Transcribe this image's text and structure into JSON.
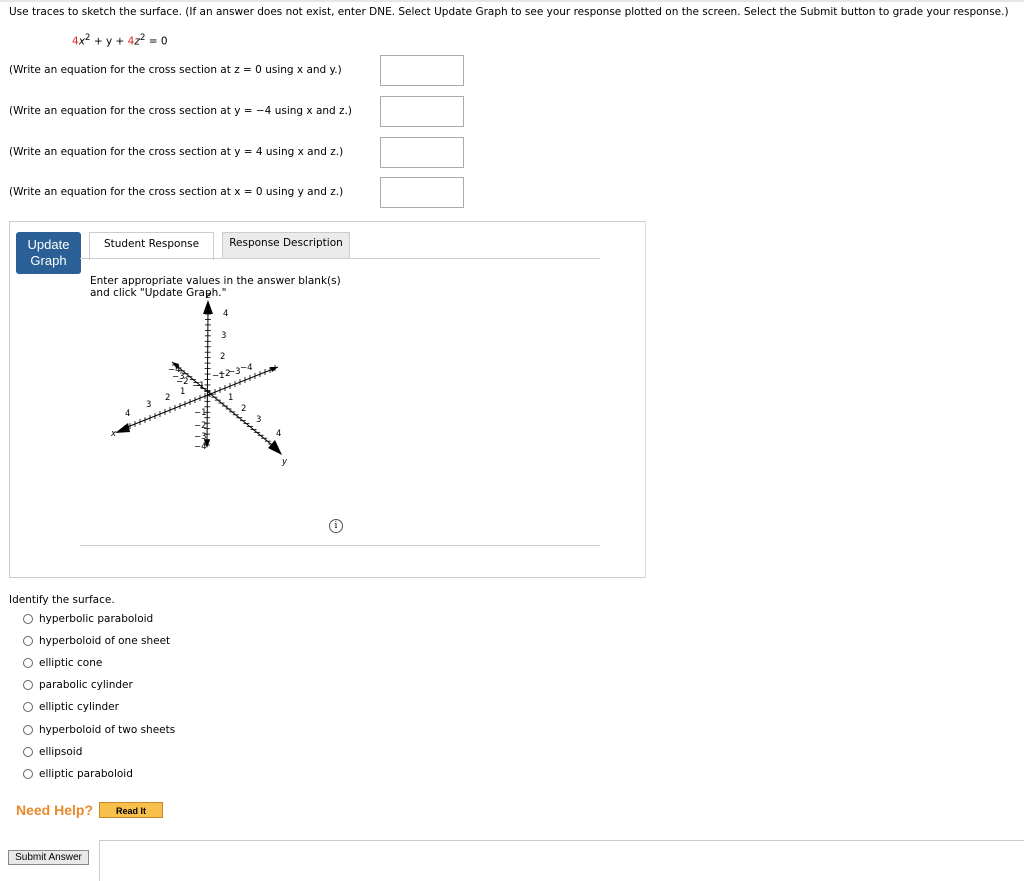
{
  "instructions": "Use traces to sketch the surface. (If an answer does not exist, enter DNE. Select Update Graph to see your response plotted on the screen. Select the Submit button to grade your response.)",
  "equation": {
    "c1": "4",
    "t1": "x",
    "s1": "2",
    "t2": " + y + ",
    "c2": "4",
    "t3": "z",
    "s2": "2",
    "t4": " = 0"
  },
  "questions": [
    {
      "label": "(Write an equation for the cross section at z = 0 using x and y.)",
      "value": ""
    },
    {
      "label": "(Write an equation for the cross section at y = −4 using x and z.)",
      "value": ""
    },
    {
      "label": "(Write an equation for the cross section at y = 4 using x and z.)",
      "value": ""
    },
    {
      "label": "(Write an equation for the cross section at x = 0 using y and z.)",
      "value": ""
    }
  ],
  "graph": {
    "update_label": "Update Graph",
    "tabs": [
      "Student Response",
      "Response Description"
    ],
    "active_tab": "Student Response",
    "message": "Enter appropriate values in the answer blank(s) and click \"Update Graph.\"",
    "axis_x": "x",
    "axis_y": "y",
    "axis_z": "z",
    "info_icon": "info-icon"
  },
  "identify_label": "Identify the surface.",
  "options": [
    "hyperbolic paraboloid",
    "hyperboloid of one sheet",
    "elliptic cone",
    "parabolic cylinder",
    "elliptic cylinder",
    "hyperboloid of two sheets",
    "ellipsoid",
    "elliptic paraboloid"
  ],
  "help": {
    "label": "Need Help?",
    "read_it": "Read It"
  },
  "submit_label": "Submit Answer",
  "colors": {
    "accent": "#2a6095",
    "coef": "#e0261b",
    "help": "#e8892b"
  }
}
